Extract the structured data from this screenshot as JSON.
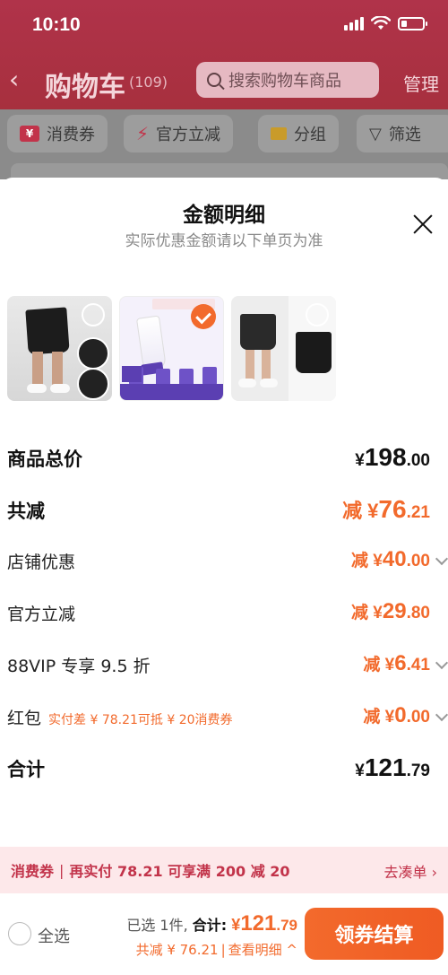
{
  "status_bar": {
    "time": "10:10"
  },
  "nav": {
    "title": "购物车",
    "count": "(109)",
    "search_placeholder": "搜索购物车商品",
    "manage": "管理"
  },
  "filters": [
    {
      "label": "消费券"
    },
    {
      "label": "官方立减"
    },
    {
      "label": "分组"
    },
    {
      "label": "筛选"
    }
  ],
  "sheet": {
    "title": "金额明细",
    "subtitle": "实际优惠金额请以下单页为准",
    "products": [
      {
        "selected": false
      },
      {
        "selected": true
      },
      {
        "selected": false
      }
    ],
    "rows": {
      "total_price": {
        "label": "商品总价",
        "prefix": "¥",
        "int": "198",
        "dec": ".00"
      },
      "total_discount": {
        "label": "共减",
        "prefix": "减 ¥",
        "int": "76",
        "dec": ".21"
      },
      "shop_discount": {
        "label": "店铺优惠",
        "prefix": "减 ¥",
        "int": "40",
        "dec": ".00"
      },
      "official_discount": {
        "label": "官方立减",
        "prefix": "减 ¥",
        "int": "29",
        "dec": ".80"
      },
      "vip_discount": {
        "label": "88VIP 专享 9.5 折",
        "prefix": "减 ¥",
        "int": "6",
        "dec": ".41"
      },
      "red_packet": {
        "label": "红包",
        "note": "实付差 ¥ 78.21可抵 ¥ 20消费券",
        "prefix": "减 ¥",
        "int": "0",
        "dec": ".00"
      },
      "sum": {
        "label": "合计",
        "prefix": "¥",
        "int": "121",
        "dec": ".79"
      }
    }
  },
  "promo": {
    "tag": "消费券",
    "text": "再实付 78.21 可享满 200 减 20",
    "link": "去凑单 ›"
  },
  "bottom": {
    "select_all": "全选",
    "selected_count": "已选 1件,",
    "total_label": "合计:",
    "total_prefix": "¥",
    "total_int": "121",
    "total_dec": ".79",
    "discount_text": "共减 ¥ 76.21",
    "detail_link": "查看明细 ^",
    "checkout": "领券结算"
  },
  "colors": {
    "accent": "#f26a2c",
    "brand_red": "#c2334a"
  }
}
